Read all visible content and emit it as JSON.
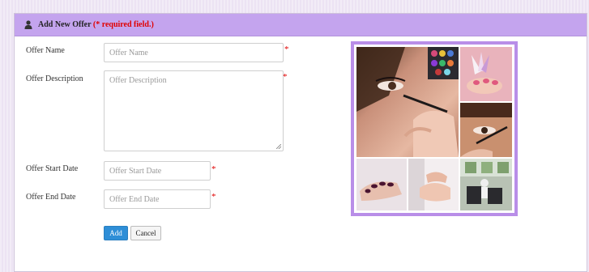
{
  "header": {
    "icon": "user-icon",
    "title": "Add New Offer",
    "required_note": "(* required field.)"
  },
  "form": {
    "offer_name": {
      "label": "Offer Name",
      "placeholder": "Offer Name",
      "value": "",
      "required_mark": "*"
    },
    "offer_description": {
      "label": "Offer Description",
      "placeholder": "Offer Description",
      "value": "",
      "required_mark": "*"
    },
    "offer_start_date": {
      "label": "Offer Start Date",
      "placeholder": "Offer Start Date",
      "value": "",
      "required_mark": "*"
    },
    "offer_end_date": {
      "label": "Offer End Date",
      "placeholder": "Offer End Date",
      "value": "",
      "required_mark": "*"
    }
  },
  "buttons": {
    "add": "Add",
    "cancel": "Cancel"
  },
  "image": {
    "tiles": [
      "eye-makeup-photo",
      "nail-polish-photo",
      "eyeliner-application-photo",
      "manicure-photo",
      "hand-care-photo",
      "salon-interior-photo"
    ]
  },
  "colors": {
    "header_bg": "#c4a4ee",
    "frame_border": "#b98ee8",
    "required": "#e00000",
    "primary_button": "#2e8ed7"
  }
}
